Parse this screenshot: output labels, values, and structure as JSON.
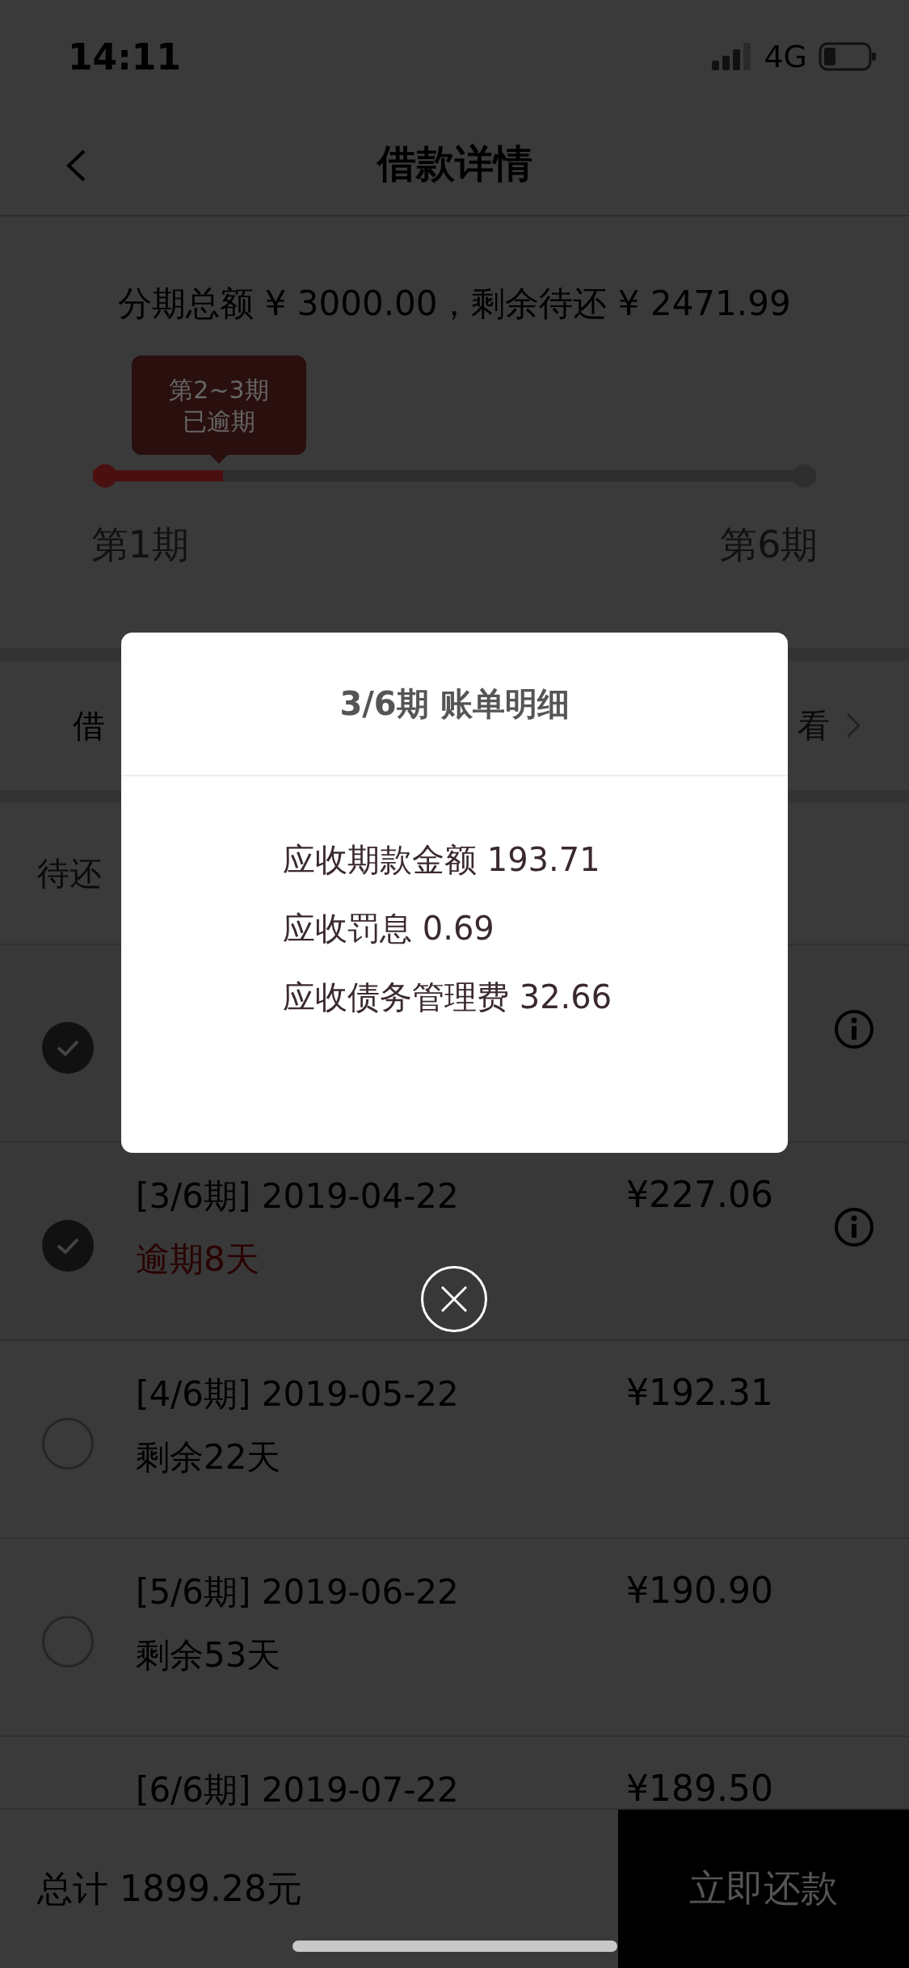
{
  "status_bar": {
    "time": "14:11",
    "network": "4G"
  },
  "nav": {
    "title": "借款详情"
  },
  "summary": {
    "text": "分期总额 ¥ 3000.00，剩余待还 ¥ 2471.99",
    "tooltip_lines": [
      "第2~3期",
      "已逾期"
    ],
    "progress": {
      "level": 0.18
    },
    "start_label": "第1期",
    "end_label": "第6期"
  },
  "receipt_row": {
    "label": "借",
    "link": "看"
  },
  "pending_header": {
    "label": "待还"
  },
  "installments": [
    {
      "checked": true
    },
    {
      "checked": true,
      "period": "[3/6期] 2019-04-22",
      "amount": "¥227.06",
      "status": "逾期8天",
      "overdue": true
    },
    {
      "checked": false,
      "period": "[4/6期] 2019-05-22",
      "amount": "¥192.31",
      "status": "剩余22天",
      "overdue": false
    },
    {
      "checked": false,
      "period": "[5/6期] 2019-06-22",
      "amount": "¥190.90",
      "status": "剩余53天",
      "overdue": false
    },
    {
      "period": "[6/6期] 2019-07-22",
      "amount": "¥189.50"
    }
  ],
  "footer": {
    "total": "总计 1899.28元",
    "button": "立即还款"
  },
  "modal": {
    "title": "3/6期 账单明细",
    "lines": [
      "应收期款金额 193.71",
      "应收罚息 0.69",
      "应收债务管理费 32.66"
    ]
  }
}
